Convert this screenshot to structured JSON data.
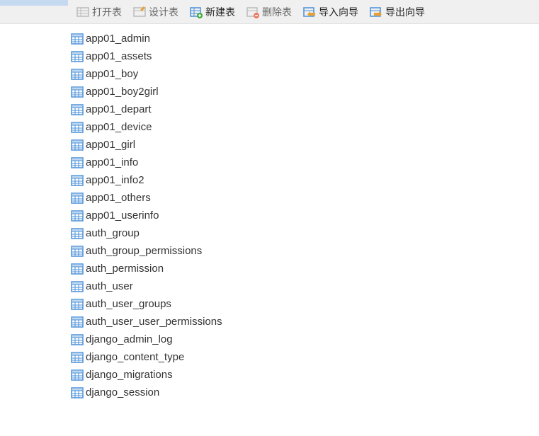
{
  "toolbar": {
    "open_table": "打开表",
    "design_table": "设计表",
    "new_table": "新建表",
    "delete_table": "删除表",
    "import_wizard": "导入向导",
    "export_wizard": "导出向导"
  },
  "tables": [
    "app01_admin",
    "app01_assets",
    "app01_boy",
    "app01_boy2girl",
    "app01_depart",
    "app01_device",
    "app01_girl",
    "app01_info",
    "app01_info2",
    "app01_others",
    "app01_userinfo",
    "auth_group",
    "auth_group_permissions",
    "auth_permission",
    "auth_user",
    "auth_user_groups",
    "auth_user_user_permissions",
    "django_admin_log",
    "django_content_type",
    "django_migrations",
    "django_session"
  ]
}
